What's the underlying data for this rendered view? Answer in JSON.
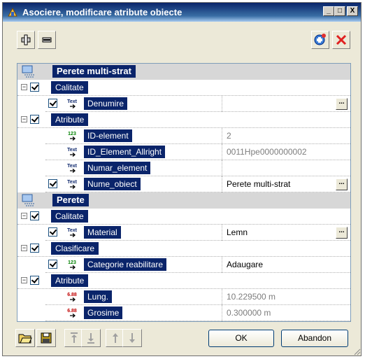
{
  "window": {
    "title": "Asociere, modificare atribute obiecte",
    "btn_min": "_",
    "btn_max": "□",
    "btn_close": "X"
  },
  "toolbar": {
    "left_icons": [
      "add-object-icon",
      "remove-object-icon"
    ],
    "right_icons": [
      "add-attribute-icon",
      "delete-attribute-icon"
    ]
  },
  "tree": {
    "sections": [
      {
        "title": "Perete multi-strat",
        "groups": [
          {
            "name": "Calitate",
            "checked": true,
            "items": [
              {
                "label": "Denumire",
                "type": "text",
                "checked": true,
                "value": "",
                "gray": false,
                "ellipsis": true
              }
            ]
          },
          {
            "name": "Atribute",
            "checked": true,
            "items": [
              {
                "label": "ID-element",
                "type": "int",
                "checked": null,
                "value": "2",
                "gray": true,
                "ellipsis": false
              },
              {
                "label": "ID_Element_Allright",
                "type": "text",
                "checked": null,
                "value": "0011Hpe0000000002",
                "gray": true,
                "ellipsis": false
              },
              {
                "label": "Numar_element",
                "type": "text",
                "checked": null,
                "value": "",
                "gray": true,
                "ellipsis": false
              },
              {
                "label": "Nume_obiect",
                "type": "text",
                "checked": true,
                "value": "Perete multi-strat",
                "gray": false,
                "ellipsis": true
              }
            ]
          }
        ]
      },
      {
        "title": "Perete",
        "groups": [
          {
            "name": "Calitate",
            "checked": true,
            "items": [
              {
                "label": "Material",
                "type": "text",
                "checked": true,
                "value": "Lemn",
                "gray": false,
                "ellipsis": true
              }
            ]
          },
          {
            "name": "Clasificare",
            "checked": true,
            "items": [
              {
                "label": "Categorie reabilitare",
                "type": "int",
                "checked": true,
                "value": "Adaugare",
                "gray": false,
                "ellipsis": false
              }
            ]
          },
          {
            "name": "Atribute",
            "checked": true,
            "items": [
              {
                "label": "Lung.",
                "type": "real",
                "checked": null,
                "value": "10.229500 m",
                "gray": true,
                "ellipsis": false
              },
              {
                "label": "Grosime",
                "type": "real",
                "checked": null,
                "value": "0.300000 m",
                "gray": true,
                "ellipsis": false
              }
            ]
          }
        ]
      }
    ]
  },
  "buttons": {
    "ok": "OK",
    "cancel": "Abandon"
  },
  "bottom_icons": [
    "open-folder-icon",
    "save-icon",
    "move-top-icon",
    "move-bottom-icon",
    "move-up-icon",
    "move-down-icon"
  ],
  "type_badges": {
    "text": "Text",
    "int": "123",
    "real": "6.88"
  }
}
